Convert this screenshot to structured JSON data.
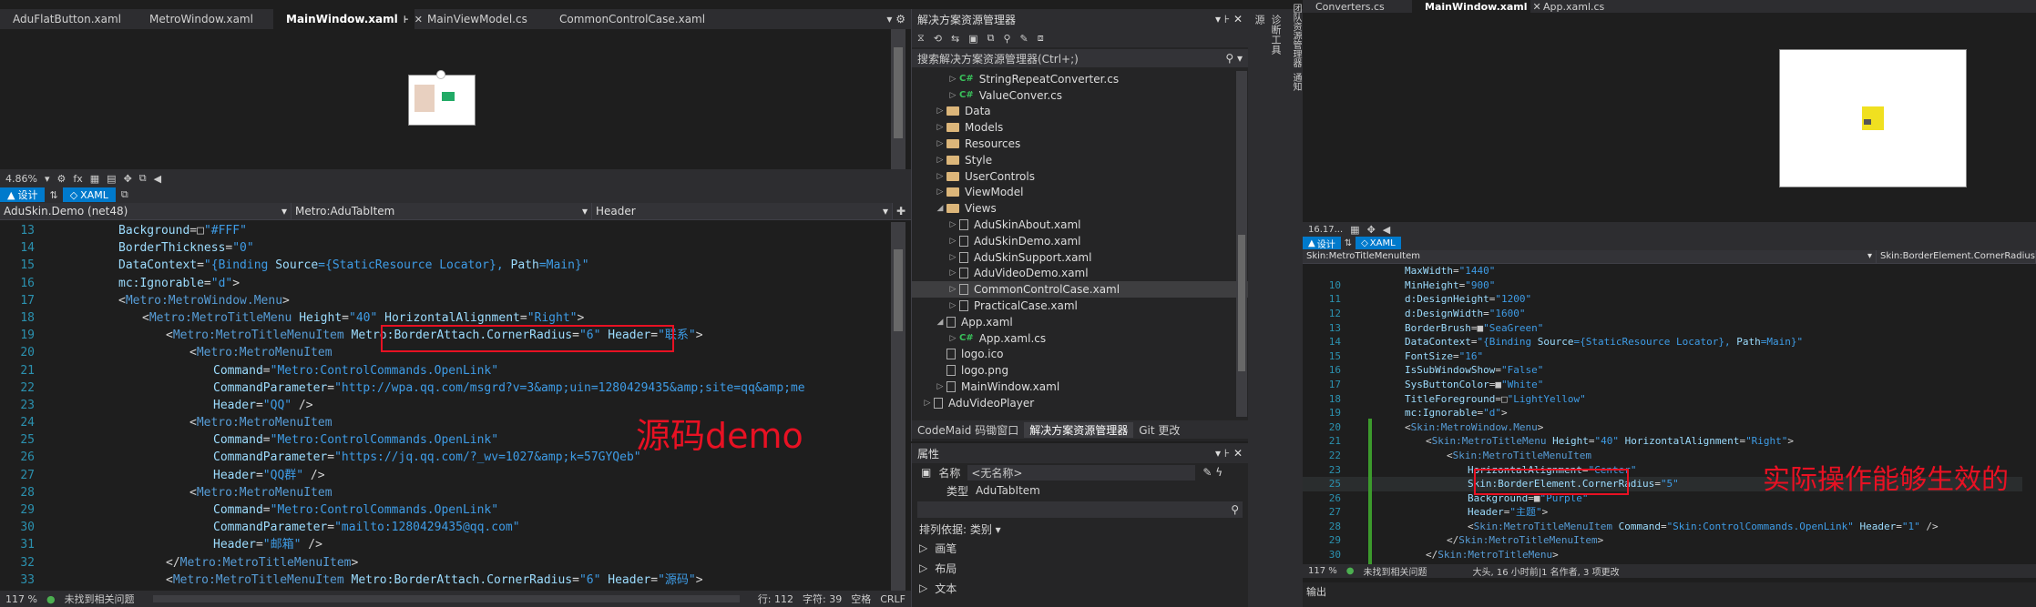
{
  "left": {
    "tabs": [
      "AduFlatButton.xaml",
      "MetroWindow.xaml",
      "MainWindow.xaml",
      "MainViewModel.cs",
      "CommonControlCase.xaml"
    ],
    "active_tab_index": 2,
    "zoom": "4.86%",
    "fx": "fx",
    "view_tabs": [
      "设计",
      "XAML"
    ],
    "nav": [
      "AduSkin.Demo (net48)",
      "Metro:AduTabItem",
      "Header"
    ],
    "lines": [
      {
        "n": "13",
        "indent": 0,
        "tokens": [
          [
            "a",
            "Background"
          ],
          [
            "p",
            "="
          ],
          [
            "k",
            "□"
          ],
          [
            "b",
            "\"#FFF\""
          ]
        ]
      },
      {
        "n": "14",
        "indent": 0,
        "tokens": [
          [
            "a",
            "BorderThickness"
          ],
          [
            "p",
            "="
          ],
          [
            "b",
            "\"0\""
          ]
        ]
      },
      {
        "n": "15",
        "indent": 0,
        "tokens": [
          [
            "a",
            "DataContext"
          ],
          [
            "p",
            "="
          ],
          [
            "b",
            "\"{Binding "
          ],
          [
            "a",
            "Source"
          ],
          [
            "b",
            "={StaticResource Locator}, "
          ],
          [
            "a",
            "Path"
          ],
          [
            "b",
            "=Main}\""
          ]
        ]
      },
      {
        "n": "16",
        "indent": 0,
        "tokens": [
          [
            "a",
            "mc:Ignorable"
          ],
          [
            "p",
            "="
          ],
          [
            "b",
            "\"d\""
          ],
          [
            "p",
            ">"
          ]
        ]
      },
      {
        "n": "17",
        "indent": 0,
        "tokens": [
          [
            "p",
            "<"
          ],
          [
            "t",
            "Metro:MetroWindow.Menu"
          ],
          [
            "p",
            ">"
          ]
        ]
      },
      {
        "n": "18",
        "indent": 1,
        "tokens": [
          [
            "p",
            "<"
          ],
          [
            "t",
            "Metro:MetroTitleMenu"
          ],
          [
            "p",
            " "
          ],
          [
            "a",
            "Height"
          ],
          [
            "p",
            "="
          ],
          [
            "b",
            "\"40\""
          ],
          [
            "p",
            " "
          ],
          [
            "a",
            "HorizontalAlignment"
          ],
          [
            "p",
            "="
          ],
          [
            "b",
            "\"Right\""
          ],
          [
            "p",
            ">"
          ]
        ]
      },
      {
        "n": "19",
        "indent": 2,
        "tokens": [
          [
            "p",
            "<"
          ],
          [
            "t",
            "Metro:MetroTitleMenuItem"
          ],
          [
            "p",
            " "
          ],
          [
            "a",
            "Metro:BorderAttach.CornerRadius"
          ],
          [
            "p",
            "="
          ],
          [
            "b",
            "\"6\""
          ],
          [
            "p",
            " "
          ],
          [
            "a",
            "Header"
          ],
          [
            "p",
            "="
          ],
          [
            "b",
            "\"联系\""
          ],
          [
            "p",
            ">"
          ]
        ]
      },
      {
        "n": "20",
        "indent": 3,
        "tokens": [
          [
            "p",
            "<"
          ],
          [
            "t",
            "Metro:MetroMenuItem"
          ]
        ]
      },
      {
        "n": "21",
        "indent": 4,
        "tokens": [
          [
            "a",
            "Command"
          ],
          [
            "p",
            "="
          ],
          [
            "b",
            "\"Metro:ControlCommands.OpenLink\""
          ]
        ]
      },
      {
        "n": "22",
        "indent": 4,
        "tokens": [
          [
            "a",
            "CommandParameter"
          ],
          [
            "p",
            "="
          ],
          [
            "b",
            "\"http://wpa.qq.com/msgrd?v=3&amp;uin=1280429435&amp;site=qq&amp;me"
          ]
        ]
      },
      {
        "n": "23",
        "indent": 4,
        "tokens": [
          [
            "a",
            "Header"
          ],
          [
            "p",
            "="
          ],
          [
            "b",
            "\"QQ\""
          ],
          [
            "p",
            " />"
          ]
        ]
      },
      {
        "n": "24",
        "indent": 3,
        "tokens": [
          [
            "p",
            "<"
          ],
          [
            "t",
            "Metro:MetroMenuItem"
          ]
        ]
      },
      {
        "n": "25",
        "indent": 4,
        "tokens": [
          [
            "a",
            "Command"
          ],
          [
            "p",
            "="
          ],
          [
            "b",
            "\"Metro:ControlCommands.OpenLink\""
          ]
        ]
      },
      {
        "n": "26",
        "indent": 4,
        "tokens": [
          [
            "a",
            "CommandParameter"
          ],
          [
            "p",
            "="
          ],
          [
            "b",
            "\"https://jq.qq.com/?_wv=1027&amp;k=57GYQeb\""
          ]
        ]
      },
      {
        "n": "27",
        "indent": 4,
        "tokens": [
          [
            "a",
            "Header"
          ],
          [
            "p",
            "="
          ],
          [
            "b",
            "\"QQ群\""
          ],
          [
            "p",
            " />"
          ]
        ]
      },
      {
        "n": "28",
        "indent": 3,
        "tokens": [
          [
            "p",
            "<"
          ],
          [
            "t",
            "Metro:MetroMenuItem"
          ]
        ]
      },
      {
        "n": "29",
        "indent": 4,
        "tokens": [
          [
            "a",
            "Command"
          ],
          [
            "p",
            "="
          ],
          [
            "b",
            "\"Metro:ControlCommands.OpenLink\""
          ]
        ]
      },
      {
        "n": "30",
        "indent": 4,
        "tokens": [
          [
            "a",
            "CommandParameter"
          ],
          [
            "p",
            "="
          ],
          [
            "b",
            "\"mailto:1280429435@qq.com\""
          ]
        ]
      },
      {
        "n": "31",
        "indent": 4,
        "tokens": [
          [
            "a",
            "Header"
          ],
          [
            "p",
            "="
          ],
          [
            "b",
            "\"邮箱\""
          ],
          [
            "p",
            " />"
          ]
        ]
      },
      {
        "n": "32",
        "indent": 2,
        "tokens": [
          [
            "p",
            "</"
          ],
          [
            "t",
            "Metro:MetroTitleMenuItem"
          ],
          [
            "p",
            ">"
          ]
        ]
      },
      {
        "n": "33",
        "indent": 2,
        "tokens": [
          [
            "p",
            "<"
          ],
          [
            "t",
            "Metro:MetroTitleMenuItem"
          ],
          [
            "p",
            " "
          ],
          [
            "a",
            "Metro:BorderAttach.CornerRadius"
          ],
          [
            "p",
            "="
          ],
          [
            "b",
            "\"6\""
          ],
          [
            "p",
            " "
          ],
          [
            "a",
            "Header"
          ],
          [
            "p",
            "="
          ],
          [
            "b",
            "\"源码\""
          ],
          [
            "p",
            ">"
          ]
        ]
      }
    ],
    "annotation": "源码demo",
    "status_zoom": "117 %",
    "status_issues": "未找到相关问题",
    "status_right": [
      "行: 112",
      "字符: 39",
      "空格",
      "CRLF"
    ]
  },
  "solution": {
    "title": "解决方案资源管理器",
    "search_placeholder": "搜索解决方案资源管理器(Ctrl+;)",
    "items": [
      {
        "label": "StringRepeatConverter.cs",
        "depth": 3,
        "kind": "cs",
        "arrow": "▷"
      },
      {
        "label": "ValueConver.cs",
        "depth": 3,
        "kind": "cs",
        "arrow": "▷"
      },
      {
        "label": "Data",
        "depth": 2,
        "kind": "folder",
        "arrow": "▷"
      },
      {
        "label": "Models",
        "depth": 2,
        "kind": "folder",
        "arrow": "▷"
      },
      {
        "label": "Resources",
        "depth": 2,
        "kind": "folder",
        "arrow": "▷"
      },
      {
        "label": "Style",
        "depth": 2,
        "kind": "folder",
        "arrow": "▷"
      },
      {
        "label": "UserControls",
        "depth": 2,
        "kind": "folder",
        "arrow": "▷"
      },
      {
        "label": "ViewModel",
        "depth": 2,
        "kind": "folder",
        "arrow": "▷"
      },
      {
        "label": "Views",
        "depth": 2,
        "kind": "folder",
        "arrow": "◢"
      },
      {
        "label": "AduSkinAbout.xaml",
        "depth": 3,
        "kind": "file",
        "arrow": "▷"
      },
      {
        "label": "AduSkinDemo.xaml",
        "depth": 3,
        "kind": "file",
        "arrow": "▷"
      },
      {
        "label": "AduSkinSupport.xaml",
        "depth": 3,
        "kind": "file",
        "arrow": "▷"
      },
      {
        "label": "AduVideoDemo.xaml",
        "depth": 3,
        "kind": "file",
        "arrow": "▷"
      },
      {
        "label": "CommonControlCase.xaml",
        "depth": 3,
        "kind": "file",
        "arrow": "▷"
      },
      {
        "label": "PracticalCase.xaml",
        "depth": 3,
        "kind": "file",
        "arrow": "▷"
      },
      {
        "label": "App.xaml",
        "depth": 2,
        "kind": "file",
        "arrow": "◢"
      },
      {
        "label": "App.xaml.cs",
        "depth": 3,
        "kind": "cs",
        "arrow": "▷"
      },
      {
        "label": "logo.ico",
        "depth": 2,
        "kind": "file",
        "arrow": ""
      },
      {
        "label": "logo.png",
        "depth": 2,
        "kind": "file",
        "arrow": ""
      },
      {
        "label": "MainWindow.xaml",
        "depth": 2,
        "kind": "file",
        "arrow": "▷"
      },
      {
        "label": "AduVideoPlayer",
        "depth": 1,
        "kind": "file",
        "arrow": "▷"
      }
    ],
    "bottom_tabs": [
      "CodeMaid 码锄窗口",
      "解决方案资源管理器",
      "Git 更改"
    ]
  },
  "props": {
    "title": "属性",
    "name_label": "名称",
    "name_value": "<无名称>",
    "type_label": "类型",
    "type_value": "AduTabItem",
    "sort_label": "排列依据: 类别 ▾",
    "groups": [
      "画笔",
      "布局",
      "文本"
    ]
  },
  "side_strip": [
    "源",
    "诊断工具",
    "团队资源管理器",
    "通知"
  ],
  "right": {
    "tabs": [
      "Converters.cs",
      "MainWindow.xaml",
      "App.xaml.cs"
    ],
    "zoom": "16.17...",
    "view_tabs": [
      "设计",
      "XAML"
    ],
    "nav_left": "Skin:MetroTitleMenuItem",
    "nav_right": "Skin:BorderElement.CornerRadius",
    "lines": [
      {
        "n": "",
        "indent": 0,
        "tokens": [
          [
            "a",
            "MaxWidth"
          ],
          [
            "p",
            "="
          ],
          [
            "b",
            "\"1440\""
          ]
        ]
      },
      {
        "n": "10",
        "indent": 0,
        "tokens": [
          [
            "a",
            "MinHeight"
          ],
          [
            "p",
            "="
          ],
          [
            "b",
            "\"900\""
          ]
        ]
      },
      {
        "n": "11",
        "indent": 0,
        "tokens": [
          [
            "a",
            "d:DesignHeight"
          ],
          [
            "p",
            "="
          ],
          [
            "b",
            "\"1200\""
          ]
        ]
      },
      {
        "n": "12",
        "indent": 0,
        "tokens": [
          [
            "a",
            "d:DesignWidth"
          ],
          [
            "p",
            "="
          ],
          [
            "b",
            "\"1600\""
          ]
        ]
      },
      {
        "n": "13",
        "indent": 0,
        "tokens": [
          [
            "a",
            "BorderBrush"
          ],
          [
            "p",
            "="
          ],
          [
            "k",
            "■"
          ],
          [
            "b",
            "\"SeaGreen\""
          ]
        ]
      },
      {
        "n": "14",
        "indent": 0,
        "tokens": [
          [
            "a",
            "DataContext"
          ],
          [
            "p",
            "="
          ],
          [
            "b",
            "\"{Binding "
          ],
          [
            "a",
            "Source"
          ],
          [
            "b",
            "={StaticResource Locator}, "
          ],
          [
            "a",
            "Path"
          ],
          [
            "b",
            "=Main}\""
          ]
        ]
      },
      {
        "n": "15",
        "indent": 0,
        "tokens": [
          [
            "a",
            "FontSize"
          ],
          [
            "p",
            "="
          ],
          [
            "b",
            "\"16\""
          ]
        ]
      },
      {
        "n": "16",
        "indent": 0,
        "tokens": [
          [
            "a",
            "IsSubWindowShow"
          ],
          [
            "p",
            "="
          ],
          [
            "b",
            "\"False\""
          ]
        ]
      },
      {
        "n": "17",
        "indent": 0,
        "tokens": [
          [
            "a",
            "SysButtonColor"
          ],
          [
            "p",
            "="
          ],
          [
            "k",
            "■"
          ],
          [
            "b",
            "\"White\""
          ]
        ]
      },
      {
        "n": "18",
        "indent": 0,
        "tokens": [
          [
            "a",
            "TitleForeground"
          ],
          [
            "p",
            "="
          ],
          [
            "k",
            "□"
          ],
          [
            "b",
            "\"LightYellow\""
          ]
        ]
      },
      {
        "n": "19",
        "indent": 0,
        "tokens": [
          [
            "a",
            "mc:Ignorable"
          ],
          [
            "p",
            "="
          ],
          [
            "b",
            "\"d\""
          ],
          [
            "p",
            ">"
          ]
        ]
      },
      {
        "n": "20",
        "indent": 0,
        "tokens": [
          [
            "p",
            "<"
          ],
          [
            "t",
            "Skin:MetroWindow.Menu"
          ],
          [
            "p",
            ">"
          ]
        ]
      },
      {
        "n": "21",
        "indent": 1,
        "tokens": [
          [
            "p",
            "<"
          ],
          [
            "t",
            "Skin:MetroTitleMenu"
          ],
          [
            "p",
            " "
          ],
          [
            "a",
            "Height"
          ],
          [
            "p",
            "="
          ],
          [
            "b",
            "\"40\""
          ],
          [
            "p",
            " "
          ],
          [
            "a",
            "HorizontalAlignment"
          ],
          [
            "p",
            "="
          ],
          [
            "b",
            "\"Right\""
          ],
          [
            "p",
            ">"
          ]
        ]
      },
      {
        "n": "22",
        "indent": 2,
        "tokens": [
          [
            "p",
            "<"
          ],
          [
            "t",
            "Skin:MetroTitleMenuItem"
          ]
        ]
      },
      {
        "n": "23",
        "indent": 3,
        "tokens": [
          [
            "a",
            "HorizontalAlignment"
          ],
          [
            "p",
            "="
          ],
          [
            "b",
            "\"Center\""
          ]
        ]
      },
      {
        "n": "25",
        "indent": 3,
        "tokens": [
          [
            "a",
            "Skin:BorderElement.CornerRadius"
          ],
          [
            "p",
            "="
          ],
          [
            "b",
            "\"5\""
          ]
        ]
      },
      {
        "n": "26",
        "indent": 3,
        "tokens": [
          [
            "a",
            "Background"
          ],
          [
            "p",
            "="
          ],
          [
            "k",
            "■"
          ],
          [
            "b",
            "\"Purple\""
          ]
        ]
      },
      {
        "n": "27",
        "indent": 3,
        "tokens": [
          [
            "a",
            "Header"
          ],
          [
            "p",
            "="
          ],
          [
            "b",
            "\"主题\""
          ],
          [
            "p",
            ">"
          ]
        ]
      },
      {
        "n": "28",
        "indent": 3,
        "tokens": [
          [
            "p",
            "<"
          ],
          [
            "t",
            "Skin:MetroTitleMenuItem"
          ],
          [
            "p",
            " "
          ],
          [
            "a",
            "Command"
          ],
          [
            "p",
            "="
          ],
          [
            "b",
            "\"Skin:ControlCommands.OpenLink\""
          ],
          [
            "p",
            " "
          ],
          [
            "a",
            "Header"
          ],
          [
            "p",
            "="
          ],
          [
            "b",
            "\"1\""
          ],
          [
            "p",
            " />"
          ]
        ]
      },
      {
        "n": "29",
        "indent": 2,
        "tokens": [
          [
            "p",
            "</"
          ],
          [
            "t",
            "Skin:MetroTitleMenuItem"
          ],
          [
            "p",
            ">"
          ]
        ]
      },
      {
        "n": "30",
        "indent": 1,
        "tokens": [
          [
            "p",
            "</"
          ],
          [
            "t",
            "Skin:MetroTitleMenu"
          ],
          [
            "p",
            ">"
          ]
        ]
      }
    ],
    "annotation": "实际操作能够生效的",
    "status_zoom": "117 %",
    "status_issues": "未找到相关问题",
    "status_extra": "大头, 16 小时前|1 名作者, 3 项更改",
    "output_label": "输出"
  }
}
